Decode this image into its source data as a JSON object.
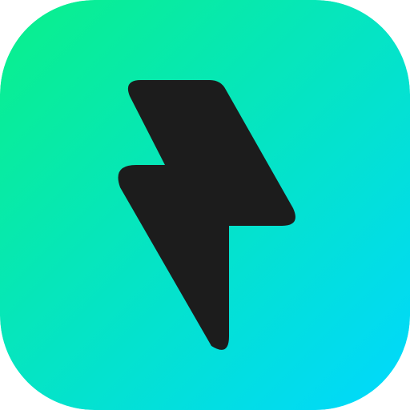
{
  "app_icon": {
    "icon": "lightning-bolt-icon",
    "colors": {
      "gradient_start": "#0AF08A",
      "gradient_end": "#00D8FF",
      "bolt_fill": "#1C1C1C"
    }
  }
}
